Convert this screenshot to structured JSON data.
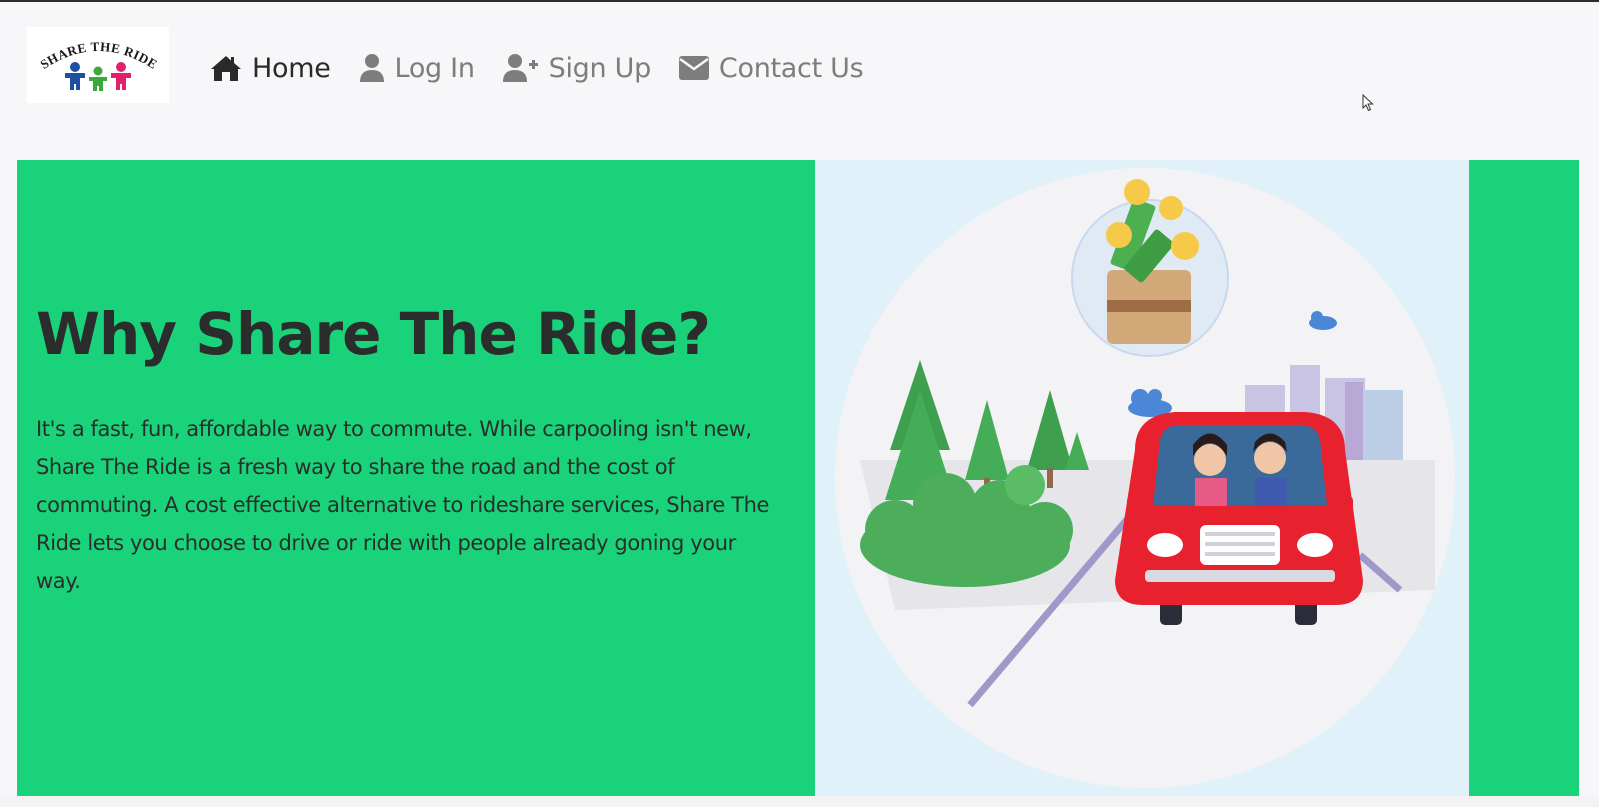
{
  "logo": {
    "text": "SHARE THE RIDE",
    "icon": "share-the-ride-people-logo"
  },
  "nav": {
    "items": [
      {
        "label": "Home",
        "icon": "home-icon",
        "active": true
      },
      {
        "label": "Log In",
        "icon": "user-icon",
        "active": false
      },
      {
        "label": "Sign Up",
        "icon": "user-plus-icon",
        "active": false
      },
      {
        "label": "Contact Us",
        "icon": "envelope-icon",
        "active": false
      }
    ]
  },
  "hero": {
    "title": "Why Share The Ride?",
    "description": "It's a fast, fun, affordable way to commute. While carpooling isn't new, Share The Ride is a fresh way to share the road and the cost of commuting. A cost effective alternative to rideshare services, Share The Ride lets you choose to drive or ride with people already goning your way.",
    "illustration": "carpool-illustration",
    "colors": {
      "background": "#19d27a",
      "illustration_bg": "#e1f1fa",
      "text": "#2a2d2b"
    }
  }
}
